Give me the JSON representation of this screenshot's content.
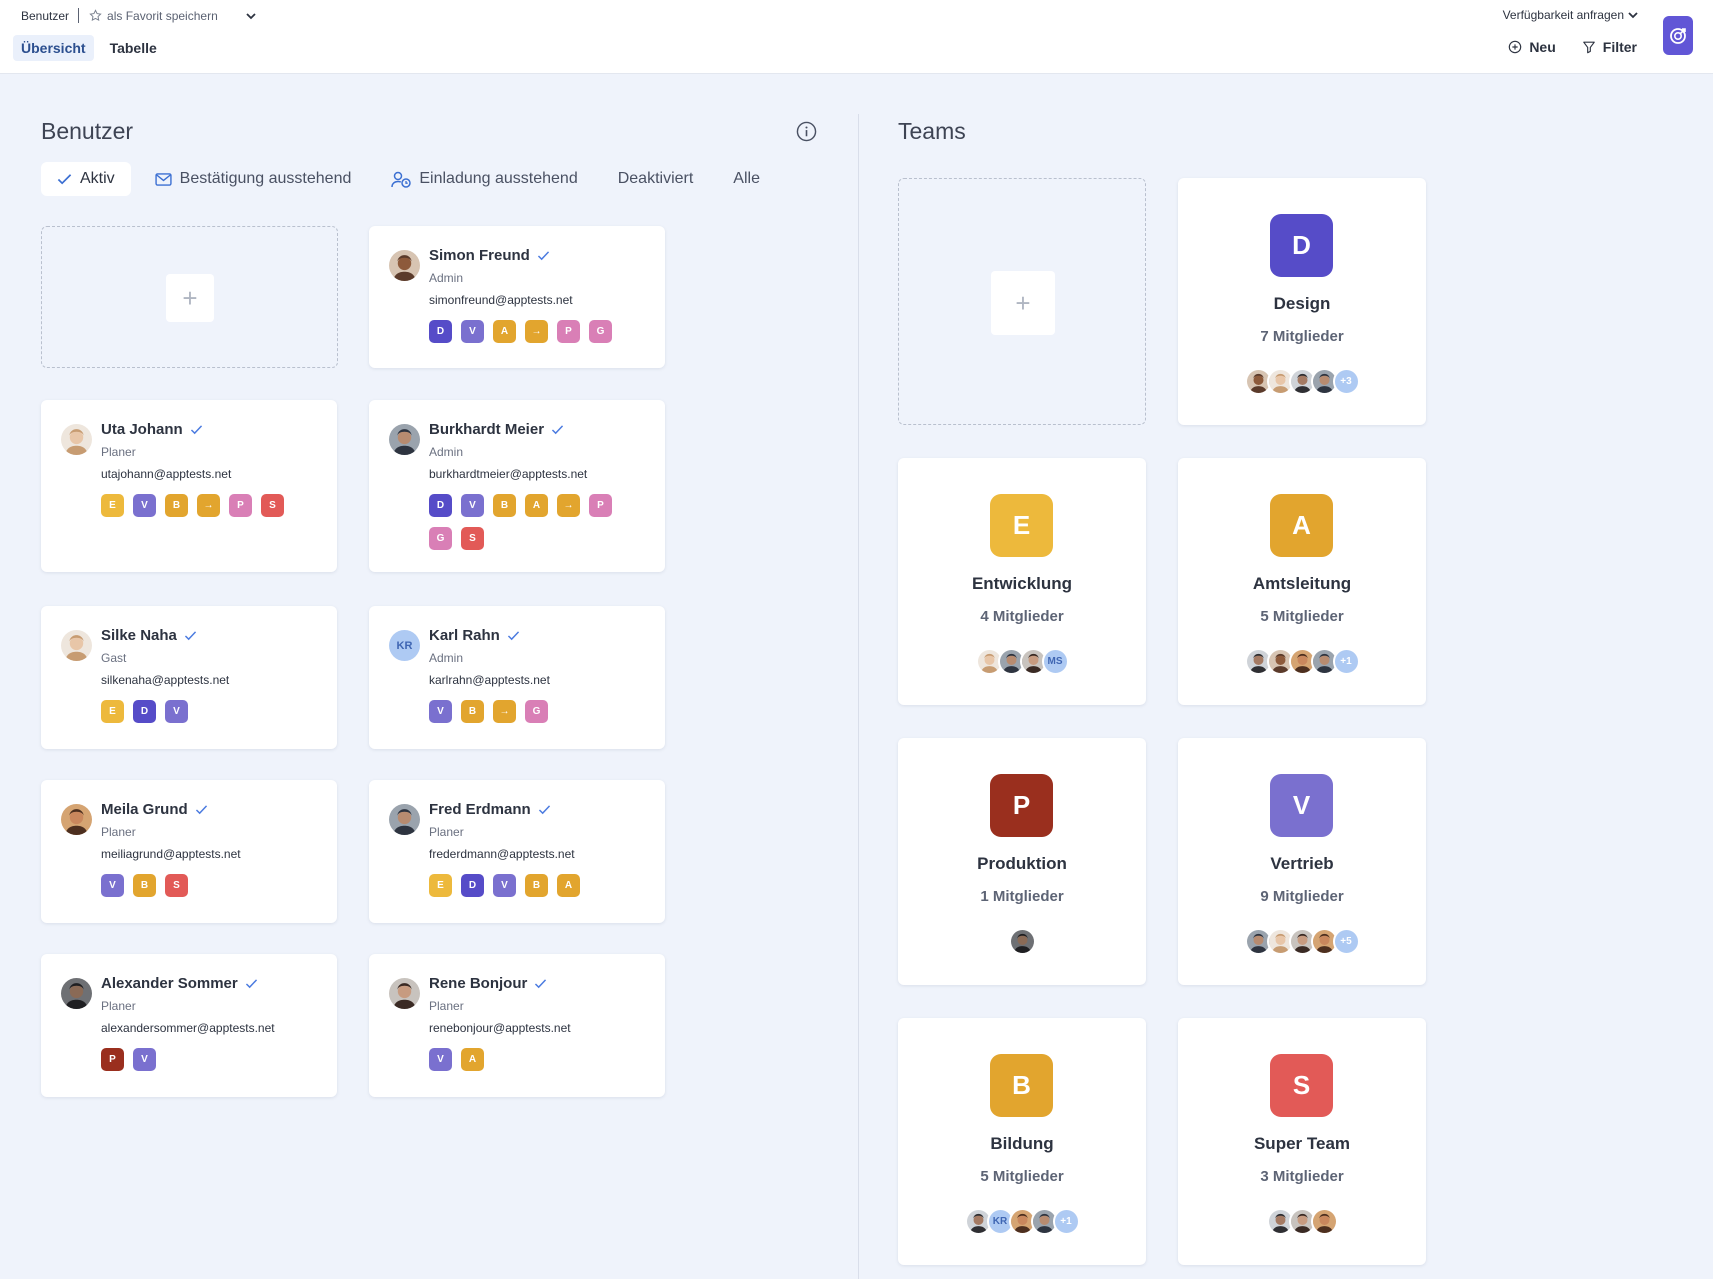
{
  "header": {
    "breadcrumb": "Benutzer",
    "favorite_label": "als Favorit speichern",
    "tabs": [
      {
        "label": "Übersicht",
        "active": true
      },
      {
        "label": "Tabelle",
        "active": false
      }
    ],
    "availability_label": "Verfügbarkeit anfragen",
    "new_label": "Neu",
    "filter_label": "Filter"
  },
  "users_panel": {
    "title": "Benutzer",
    "filters": [
      {
        "label": "Aktiv",
        "icon": "check-icon",
        "active": true
      },
      {
        "label": "Bestätigung ausstehend",
        "icon": "mail-icon",
        "active": false
      },
      {
        "label": "Einladung ausstehend",
        "icon": "user-clock-icon",
        "active": false
      },
      {
        "label": "Deaktiviert",
        "icon": "",
        "active": false
      },
      {
        "label": "Alle",
        "icon": "",
        "active": false
      }
    ],
    "add_label": "+",
    "users": [
      {
        "name": "Simon Freund",
        "role": "Admin",
        "email": "simonfreund@apptests.net",
        "badges": [
          "D",
          "V",
          "A",
          "→",
          "P",
          "G"
        ]
      },
      {
        "name": "Uta Johann",
        "role": "Planer",
        "email": "utajohann@apptests.net",
        "badges": [
          "E",
          "V",
          "B",
          "→",
          "P",
          "S"
        ]
      },
      {
        "name": "Burkhardt Meier",
        "role": "Admin",
        "email": "burkhardtmeier@apptests.net",
        "badges": [
          "D",
          "V",
          "B",
          "A",
          "→",
          "P",
          "G",
          "S"
        ]
      },
      {
        "name": "Silke Naha",
        "role": "Gast",
        "email": "silkenaha@apptests.net",
        "badges": [
          "E",
          "D",
          "V"
        ]
      },
      {
        "name": "Karl Rahn",
        "role": "Admin",
        "email": "karlrahn@apptests.net",
        "initials": "KR",
        "badges": [
          "V",
          "B",
          "→",
          "G"
        ]
      },
      {
        "name": "Meila Grund",
        "role": "Planer",
        "email": "meiliagrund@apptests.net",
        "badges": [
          "V",
          "B",
          "S"
        ]
      },
      {
        "name": "Fred Erdmann",
        "role": "Planer",
        "email": "frederdmann@apptests.net",
        "badges": [
          "E",
          "D",
          "V",
          "B",
          "A"
        ]
      },
      {
        "name": "Alexander Sommer",
        "role": "Planer",
        "email": "alexandersommer@apptests.net",
        "badges": [
          "P",
          "V"
        ]
      },
      {
        "name": "Rene Bonjour",
        "role": "Planer",
        "email": "renebonjour@apptests.net",
        "badges": [
          "V",
          "A"
        ]
      }
    ]
  },
  "teams_panel": {
    "title": "Teams",
    "add_label": "+",
    "teams": [
      {
        "letter": "D",
        "name": "Design",
        "count": "7 Mitglieder",
        "color": "#564cc8",
        "members": [
          "a1",
          "a2",
          "a3",
          "a4"
        ],
        "more": "+3"
      },
      {
        "letter": "E",
        "name": "Entwicklung",
        "count": "4 Mitglieder",
        "color": "#edb93c",
        "members": [
          "a2",
          "a4",
          "a5"
        ],
        "initials": "MS",
        "more": ""
      },
      {
        "letter": "A",
        "name": "Amtsleitung",
        "count": "5 Mitglieder",
        "color": "#e2a52e",
        "members": [
          "a3",
          "a1",
          "a6",
          "a4"
        ],
        "more": "+1"
      },
      {
        "letter": "P",
        "name": "Produktion",
        "count": "1 Mitglieder",
        "color": "#9a2f1e",
        "members": [
          "a7"
        ],
        "more": ""
      },
      {
        "letter": "V",
        "name": "Vertrieb",
        "count": "9 Mitglieder",
        "color": "#7a70cf",
        "members": [
          "a4",
          "a2",
          "a5",
          "a6"
        ],
        "more": "+5"
      },
      {
        "letter": "B",
        "name": "Bildung",
        "count": "5 Mitglieder",
        "color": "#e2a52e",
        "members": [
          "a3"
        ],
        "initials": "KR",
        "members_after": [
          "a6",
          "a4"
        ],
        "more": "+1"
      },
      {
        "letter": "S",
        "name": "Super Team",
        "count": "3 Mitglieder",
        "color": "#e25a57",
        "members": [
          "a3",
          "a5",
          "a6"
        ],
        "more": ""
      }
    ]
  },
  "badge_colors": {
    "D": "#564cc8",
    "V": "#7a70cf",
    "A": "#e2a52e",
    "→": "#e2a52e",
    "P": "#d97fb6",
    "G": "#d97fb6",
    "E": "#edb93c",
    "B": "#e2a52e",
    "S": "#e25a57"
  },
  "badge_overrides": {
    "Alexander Sommer:P": "#9a2f1e"
  }
}
